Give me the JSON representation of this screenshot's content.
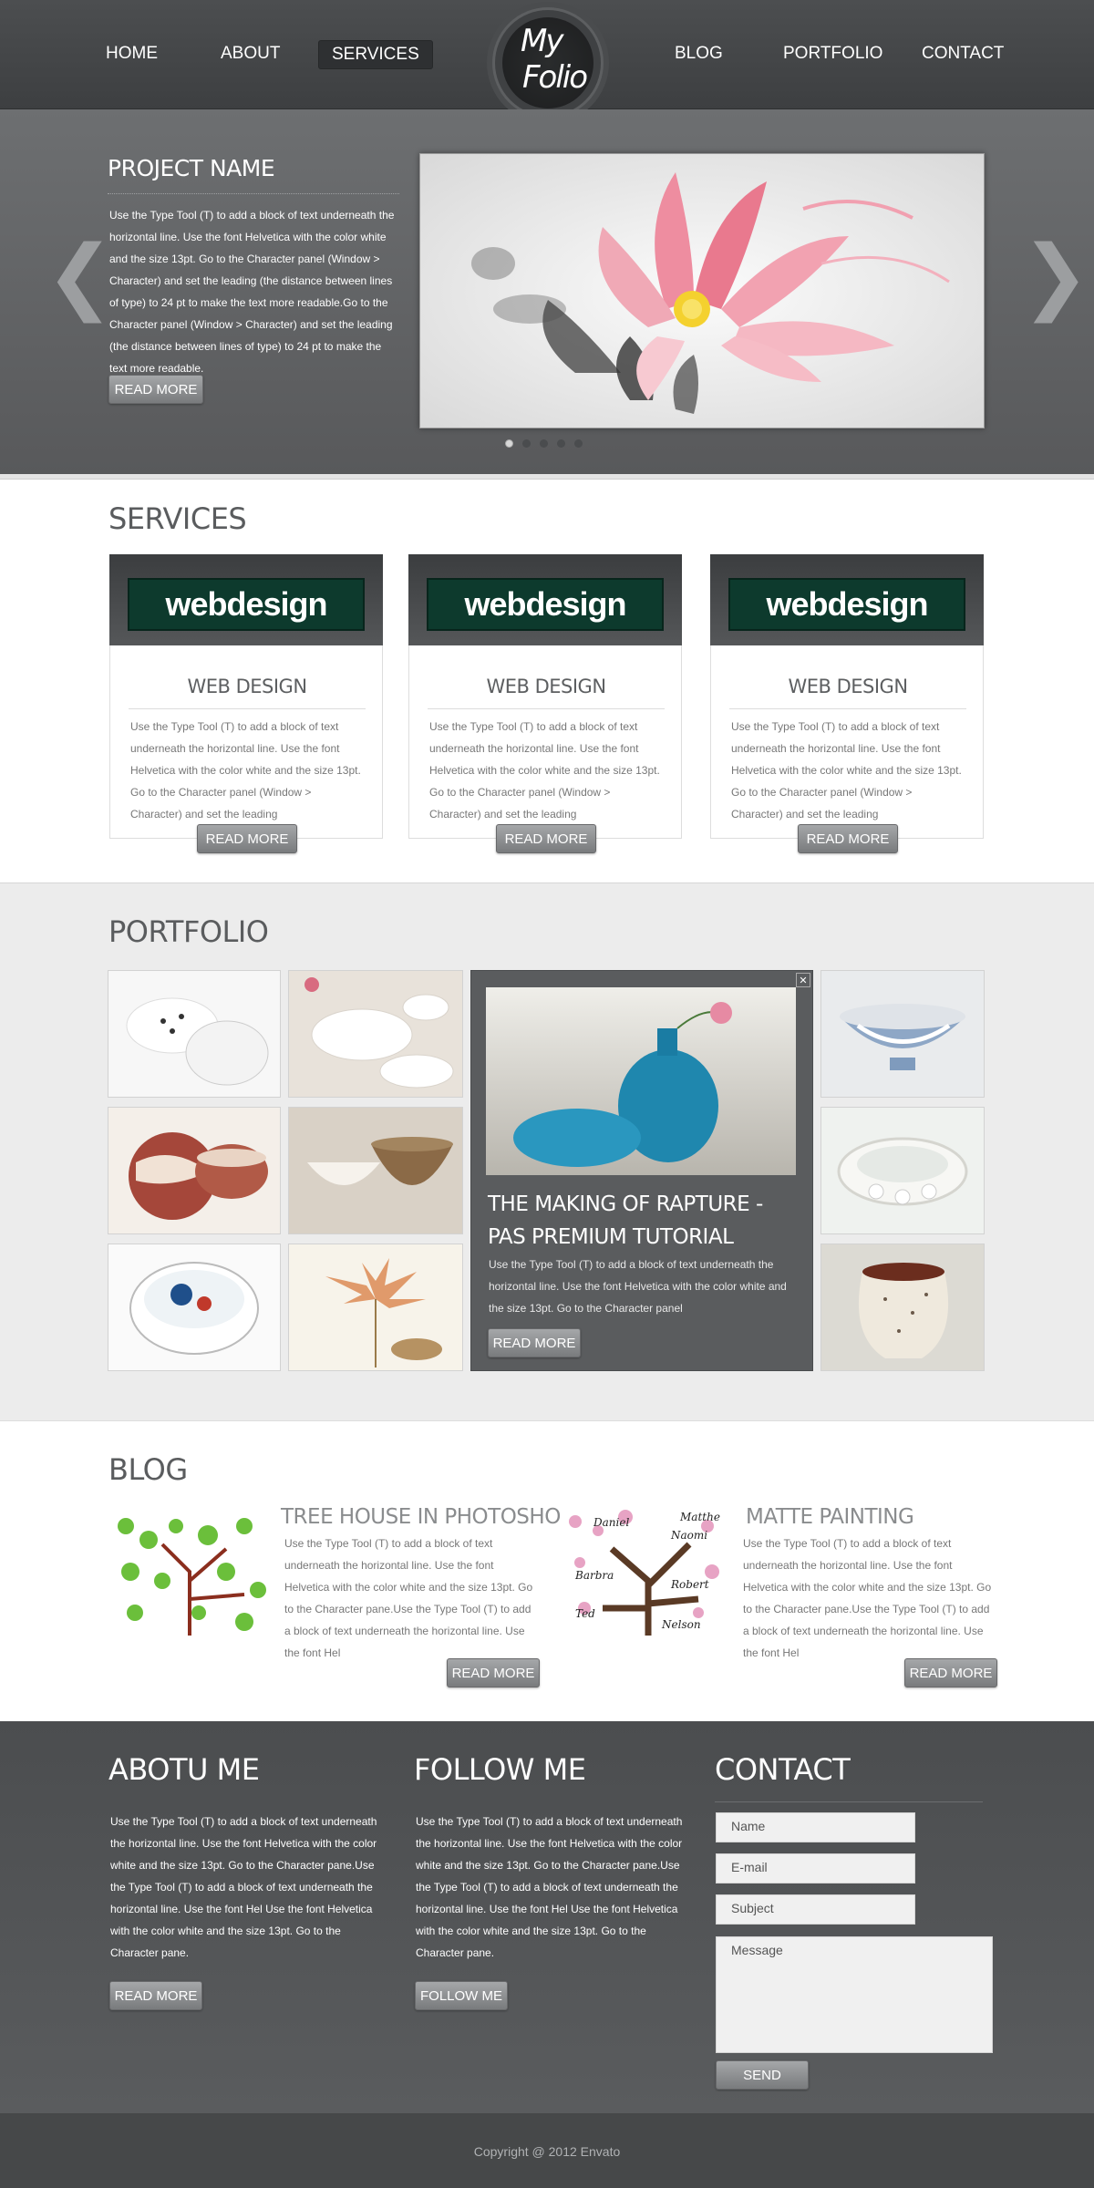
{
  "nav": {
    "left_items": [
      "HOME",
      "ABOUT",
      "SERVICES"
    ],
    "right_items": [
      "BLOG",
      "PORTFOLIO",
      "CONTACT"
    ],
    "logo_line1": "My",
    "logo_line2": "Folio"
  },
  "slider": {
    "title": "PROJECT NAME",
    "text": "Use the Type Tool (T) to add a block of text underneath the horizontal line. Use the font Helvetica with the color white and the size 13pt. Go to the Character panel (Window > Character) and set the leading (the distance between lines of type) to 24 pt to make the text more readable.Go to the Character panel (Window > Character) and set the leading (the distance between lines of type) to 24 pt to make the text more readable.",
    "button": "READ MORE",
    "prev_arrow": "❮",
    "next_arrow": "❯"
  },
  "services": {
    "title": "SERVICES",
    "items": [
      {
        "sign": "webdesign",
        "heading": "WEB DESIGN",
        "text": "Use the Type Tool (T) to add a block of text underneath the horizontal line. Use the font Helvetica with the color white and the size 13pt. Go to the Character panel (Window > Character) and set the leading",
        "button": "READ MORE"
      },
      {
        "sign": "webdesign",
        "heading": "WEB DESIGN",
        "text": "Use the Type Tool (T) to add a block of text underneath the horizontal line. Use the font Helvetica with the color white and the size 13pt. Go to the Character panel (Window > Character) and set the leading",
        "button": "READ MORE"
      },
      {
        "sign": "webdesign",
        "heading": "WEB DESIGN",
        "text": "Use the Type Tool (T) to add a block of text underneath the horizontal line. Use the font Helvetica with the color white and the size 13pt. Go to the Character panel (Window > Character) and set the leading",
        "button": "READ MORE"
      }
    ]
  },
  "portfolio": {
    "title": "PORTFOLIO",
    "feature_title": "THE MAKING OF RAPTURE - PAS PREMIUM TUTORIAL",
    "feature_text": "Use the Type Tool (T) to add a block of text underneath the horizontal line. Use the font Helvetica with the color white and the size 13pt. Go to the Character panel",
    "feature_button": "READ MORE",
    "close_symbol": "✕"
  },
  "blog": {
    "title": "BLOG",
    "posts": [
      {
        "title": "TREE HOUSE IN PHOTOSHOP",
        "text": "Use the Type Tool (T) to add a block of text underneath the horizontal line. Use the font Helvetica with the color white and the size 13pt. Go to the Character pane.Use the Type Tool (T) to add a block of text underneath the horizontal line. Use the font Hel",
        "button": "READ MORE"
      },
      {
        "title": "MATTE PAINTING",
        "text": "Use the Type Tool (T) to add a block of text underneath the horizontal line. Use the font Helvetica with the color white and the size 13pt. Go to the Character pane.Use the Type Tool (T) to add a block of text underneath the horizontal line. Use the font Hel",
        "button": "READ MORE",
        "names": [
          "Daniel",
          "Matthe",
          "Naomi",
          "Barbra",
          "Robert",
          "Ted",
          "Nelson"
        ]
      }
    ]
  },
  "footer": {
    "about_title": "ABOTU ME",
    "about_text": "Use the Type Tool (T) to add a block of text underneath the horizontal line. Use the font Helvetica with the color white and the size 13pt. Go to the Character pane.Use the Type Tool (T) to add a block of text underneath the horizontal line. Use the font Hel Use the font Helvetica with the color white and the size 13pt. Go to the Character pane.",
    "about_button": "READ MORE",
    "follow_title": "FOLLOW ME",
    "follow_text": "Use the Type Tool (T) to add a block of text underneath the horizontal line. Use the font Helvetica with the color white and the size 13pt. Go to the Character pane.Use the Type Tool (T) to add a block of text underneath the horizontal line. Use the font Hel Use the font Helvetica with the color white and the size 13pt. Go to the Character pane.",
    "follow_button": "FOLLOW ME",
    "contact_title": "CONTACT",
    "name_placeholder": "Name",
    "email_placeholder": "E-mail",
    "subject_placeholder": "Subject",
    "message_placeholder": "Message",
    "send_button": "SEND"
  },
  "copyright": "Copyright @ 2012 Envato",
  "colors": {
    "header": "#434547",
    "slider": "#636567",
    "footer": "#525456",
    "button": "#8e9092",
    "accent_pink": "#e9798e"
  }
}
